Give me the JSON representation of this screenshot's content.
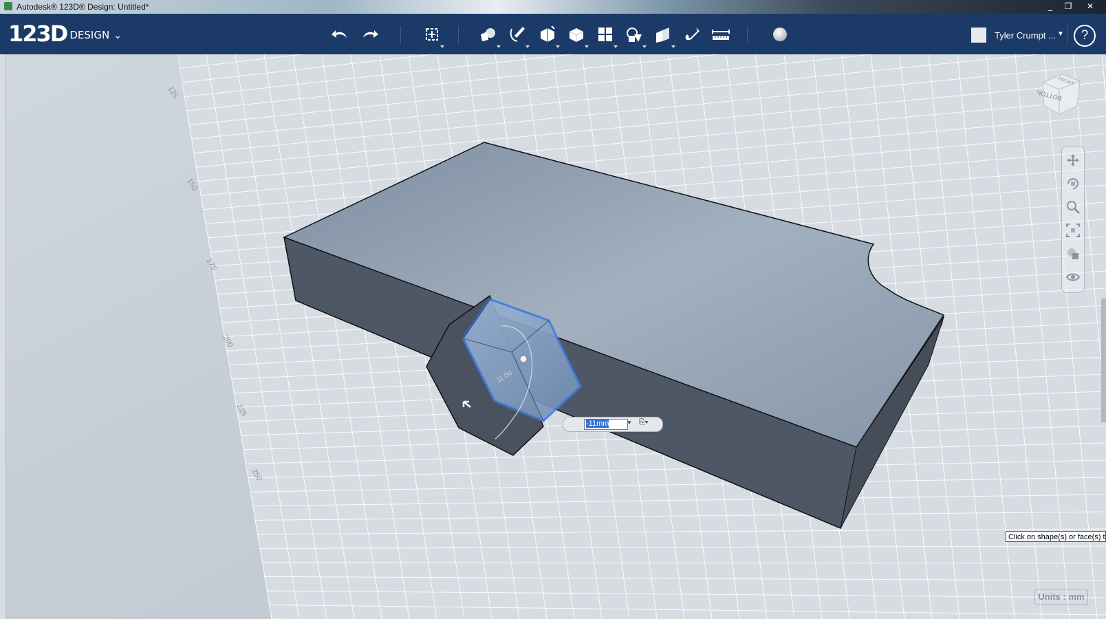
{
  "window": {
    "title": "Autodesk® 123D® Design: Untitled*",
    "buttons": [
      "_",
      "❐",
      "✕"
    ]
  },
  "app": {
    "logo_main": "123D",
    "logo_sub": "DESIGN",
    "logo_chevron": "⌄"
  },
  "toolbar": {
    "tools": [
      "undo",
      "redo",
      "transform",
      "primitives",
      "sketch",
      "construct",
      "modify",
      "pattern",
      "grouping",
      "combine",
      "measure-snap",
      "measure",
      "material"
    ]
  },
  "user": {
    "name": "Tyler Crumpt ...",
    "dropdown": "▼",
    "help": "?"
  },
  "grid_labels": [
    "125",
    "150",
    "175",
    "200",
    "225",
    "250"
  ],
  "viewcube": {
    "faces": [
      "FRONT",
      "BOTTOM"
    ]
  },
  "manipulator": {
    "angle_label": "11.00",
    "dimension_value": "-11mm"
  },
  "tooltip": "Click on shape(s) or face(s) to",
  "units": "Units : mm",
  "colors": {
    "toolbar_bg": "#1c3a67",
    "viewport_bg": "#c9d1d9",
    "solid_side": "#4f5866",
    "solid_top": "#8c9aab",
    "selection": "#3f7be0"
  }
}
